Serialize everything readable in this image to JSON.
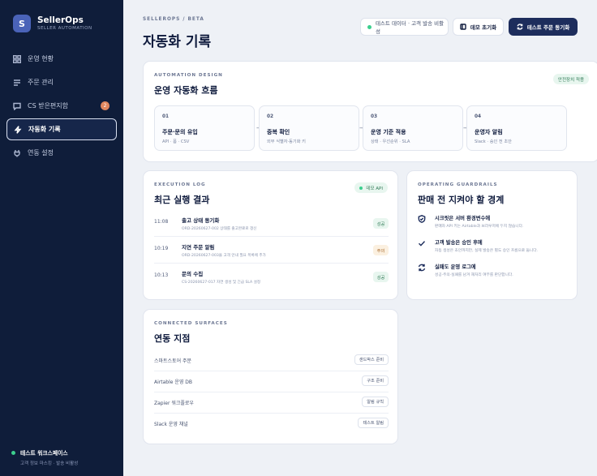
{
  "brand": {
    "logo_letter": "S",
    "name": "SellerOps",
    "subtitle": "SELLER AUTOMATION"
  },
  "sidebar": {
    "items": [
      {
        "label": "운영 현황",
        "icon": "grid-icon",
        "active": false
      },
      {
        "label": "주문 관리",
        "icon": "list-icon",
        "active": false
      },
      {
        "label": "CS 받은편지함",
        "icon": "chat-icon",
        "active": false,
        "badge": "2"
      },
      {
        "label": "자동화 기록",
        "icon": "bolt-icon",
        "active": true
      },
      {
        "label": "연동 설정",
        "icon": "plug-icon",
        "active": false
      }
    ],
    "workspace": {
      "title": "테스트 워크스페이스",
      "subtitle": "고객 정보 마스킹 · 발송 비활성",
      "status_color": "#3ccf8e"
    }
  },
  "header": {
    "eyebrow": "SELLEROPS / BETA",
    "title": "자동화 기록",
    "data_chip": "테스트 데이터 · 고객 발송 비활성",
    "reset_button": "데모 초기화",
    "sync_button": "테스트 주문 동기화"
  },
  "flow": {
    "eyebrow": "AUTOMATION DESIGN",
    "title": "운영 자동화 흐름",
    "badge": "안전장치 적용",
    "steps": [
      {
        "num": "01",
        "name": "주문·문의 유입",
        "desc": "API · 폼 · CSV"
      },
      {
        "num": "02",
        "name": "중복 확인",
        "desc": "외부 식별자·동기화 키"
      },
      {
        "num": "03",
        "name": "운영 기준 적용",
        "desc": "상태 · 우선순위 · SLA"
      },
      {
        "num": "04",
        "name": "운영자 알림",
        "desc": "Slack · 승인 전 초안"
      }
    ]
  },
  "log": {
    "eyebrow": "EXECUTION LOG",
    "title": "최근 실행 결과",
    "badge": "데모 API",
    "rows": [
      {
        "time": "11:08",
        "title": "출고 상태 동기화",
        "desc": "ORD-20260627-002 상태를 출고완료로 갱신",
        "status": "성공",
        "kind": "ok"
      },
      {
        "time": "10:19",
        "title": "지연 주문 알림",
        "desc": "ORD-20260627-003을 고객 안내 필요 목록에 추가",
        "status": "주의",
        "kind": "warn"
      },
      {
        "time": "10:13",
        "title": "문의 수집",
        "desc": "CS-20260627-017 자연 생성 및 긴급 SLA 설정",
        "status": "성공",
        "kind": "ok"
      }
    ]
  },
  "guard": {
    "eyebrow": "OPERATING GUARDRAILS",
    "title": "판매 전 지켜야 할 경계",
    "items": [
      {
        "icon": "shield-icon",
        "title": "시크릿은 서버 환경변수에",
        "desc": "판매자 API 키는 Airtable과 브라우저에 두지 않습니다."
      },
      {
        "icon": "check-icon",
        "title": "고객 발송은 승인 후에",
        "desc": "자동 생성은 초안까지만, 실제 발송은 별도 승인 흐름으로 둡니다."
      },
      {
        "icon": "refresh-icon",
        "title": "실패도 운영 로그에",
        "desc": "성공·주의·실패를 남겨 재처리 여부를 판단합니다."
      }
    ]
  },
  "surfaces": {
    "eyebrow": "CONNECTED SURFACES",
    "title": "연동 지점",
    "rows": [
      {
        "name": "스마트스토어 주문",
        "tag": "샌드박스 준비"
      },
      {
        "name": "Airtable 운영 DB",
        "tag": "구조 준비"
      },
      {
        "name": "Zapier 워크플로우",
        "tag": "알림 규칙"
      },
      {
        "name": "Slack 운영 채널",
        "tag": "테스트 알림"
      }
    ]
  }
}
